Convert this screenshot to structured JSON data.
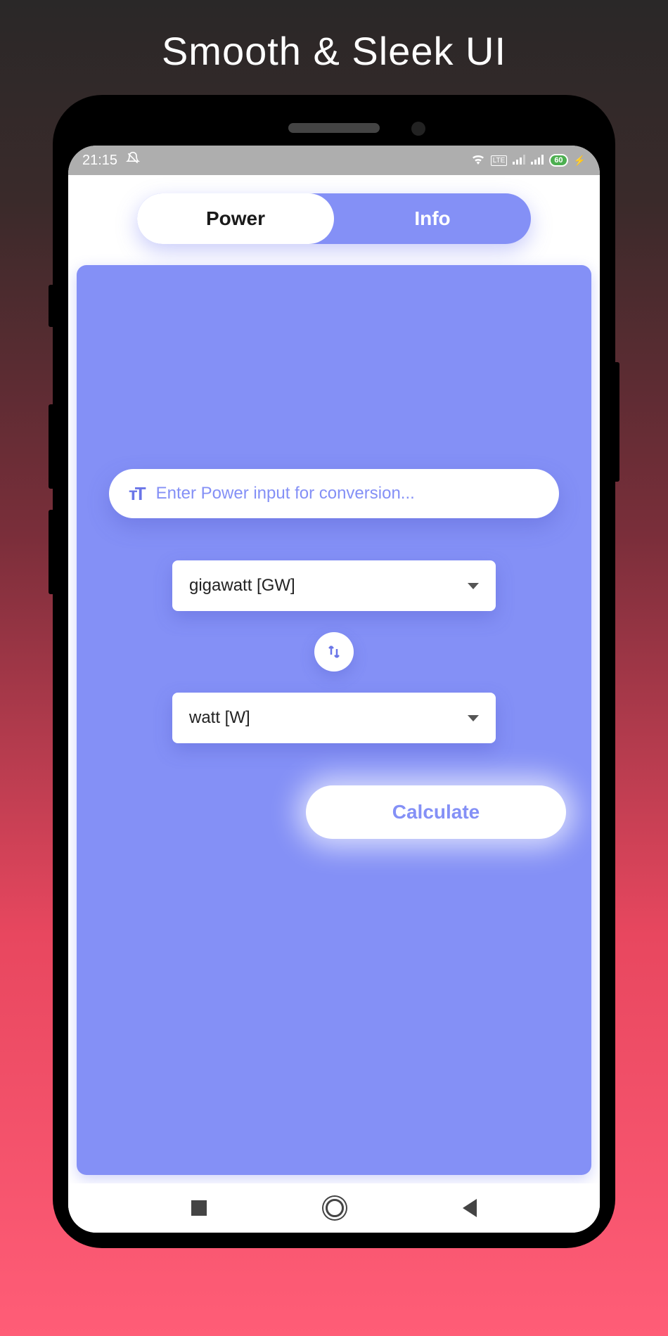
{
  "promo": {
    "title": "Smooth & Sleek UI"
  },
  "status": {
    "time": "21:15",
    "battery": "60"
  },
  "tabs": {
    "power": "Power",
    "info": "Info"
  },
  "converter": {
    "input_placeholder": "Enter Power input for conversion...",
    "from_unit": "gigawatt [GW]",
    "to_unit": "watt [W]",
    "calculate_label": "Calculate"
  }
}
